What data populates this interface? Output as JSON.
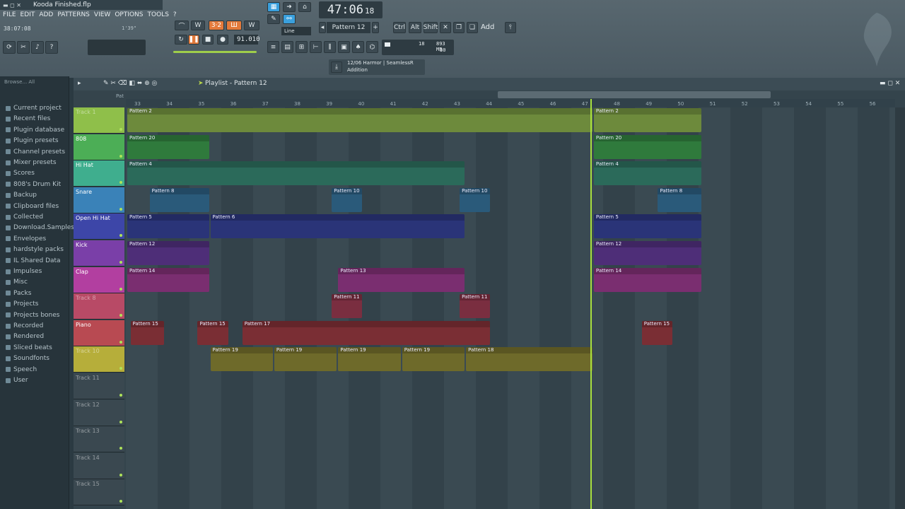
{
  "window": {
    "title": "Kooda Finished.flp"
  },
  "menu": [
    "FILE",
    "EDIT",
    "ADD",
    "PATTERNS",
    "VIEW",
    "OPTIONS",
    "TOOLS",
    "?"
  ],
  "hint": {
    "time": "38:07:08",
    "small": "1'39\""
  },
  "transport": {
    "time": "47:06",
    "time_sub": "18",
    "tempo": "91.010",
    "pattern": "Pattern 12",
    "snap": "Line",
    "pat_label": "Pat"
  },
  "shortcuts": [
    "Ctrl",
    "Alt",
    "Shift"
  ],
  "add_label": "Add",
  "cpu": {
    "value": "18",
    "mem": "893 MB",
    "poly": "30"
  },
  "hint_bar": {
    "line1": "12/06  Harmor | SeamlessR",
    "line2": "Addition"
  },
  "playlist": {
    "title": "Playlist - Pattern 12"
  },
  "browser": {
    "header": "Browse... All",
    "items": [
      "Current project",
      "Recent files",
      "Plugin database",
      "Plugin presets",
      "Channel presets",
      "Mixer presets",
      "Scores",
      "808's Drum Kit",
      "Backup",
      "Clipboard files",
      "Collected",
      "Download.Samples",
      "Envelopes",
      "hardstyle packs",
      "IL Shared Data",
      "Impulses",
      "Misc",
      "Packs",
      "Projects",
      "Projects bones",
      "Recorded",
      "Rendered",
      "Sliced beats",
      "Soundfonts",
      "Speech",
      "User"
    ]
  },
  "ruler": [
    "33",
    "34",
    "35",
    "36",
    "37",
    "38",
    "39",
    "40",
    "41",
    "42",
    "43",
    "44",
    "45",
    "46",
    "47",
    "48",
    "49",
    "50",
    "51",
    "52",
    "53",
    "54",
    "55",
    "56"
  ],
  "tracks": [
    {
      "name": "Track 1",
      "color": "#8fbf4a"
    },
    {
      "name": "808",
      "color": "#4cae56"
    },
    {
      "name": "Hi Hat",
      "color": "#3fae8e"
    },
    {
      "name": "Snare",
      "color": "#3a82b8"
    },
    {
      "name": "Open Hi Hat",
      "color": "#3d46a8"
    },
    {
      "name": "Kick",
      "color": "#7a3fa8"
    },
    {
      "name": "Clap",
      "color": "#b23fa0"
    },
    {
      "name": "Track 8",
      "color": "#b84a66"
    },
    {
      "name": "Piano",
      "color": "#b84a52"
    },
    {
      "name": "Track 10",
      "color": "#b6ae3a"
    },
    {
      "name": "Track 11",
      "color": "#3a4850"
    },
    {
      "name": "Track 12",
      "color": "#3a4850"
    },
    {
      "name": "Track 13",
      "color": "#3a4850"
    },
    {
      "name": "Track 14",
      "color": "#3a4850"
    },
    {
      "name": "Track 15",
      "color": "#3a4850"
    }
  ],
  "clips": [
    {
      "track": 0,
      "label": "Pattern 2",
      "start": 0,
      "end": 14.6,
      "color": "#6d8a3c"
    },
    {
      "track": 0,
      "label": "Pattern 2",
      "start": 14.6,
      "end": 18,
      "color": "#6d8a3c"
    },
    {
      "track": 1,
      "label": "Pattern 20",
      "start": 0,
      "end": 2.6,
      "color": "#2f7a3c"
    },
    {
      "track": 1,
      "label": "Pattern 20",
      "start": 14.6,
      "end": 18,
      "color": "#2f7a3c"
    },
    {
      "track": 2,
      "label": "Pattern 4",
      "start": 0,
      "end": 10.6,
      "color": "#2b6a5a"
    },
    {
      "track": 2,
      "label": "Pattern 4",
      "start": 14.6,
      "end": 18,
      "color": "#2b6a5a"
    },
    {
      "track": 3,
      "label": "Pattern 8",
      "start": 0.7,
      "end": 2.6,
      "color": "#2a5a7a"
    },
    {
      "track": 3,
      "label": "Pattern 10",
      "start": 6.4,
      "end": 7.4,
      "color": "#2a5a7a"
    },
    {
      "track": 3,
      "label": "Pattern 10",
      "start": 10.4,
      "end": 11.4,
      "color": "#2a5a7a"
    },
    {
      "track": 3,
      "label": "Pattern 8",
      "start": 16.6,
      "end": 18,
      "color": "#2a5a7a"
    },
    {
      "track": 4,
      "label": "Pattern 5",
      "start": 0,
      "end": 2.6,
      "color": "#2a3478"
    },
    {
      "track": 4,
      "label": "Pattern 6",
      "start": 2.6,
      "end": 10.6,
      "color": "#2a3478"
    },
    {
      "track": 4,
      "label": "Pattern 5",
      "start": 14.6,
      "end": 18,
      "color": "#2a3478"
    },
    {
      "track": 5,
      "label": "Pattern 12",
      "start": 0,
      "end": 2.6,
      "color": "#4e2e78"
    },
    {
      "track": 5,
      "label": "Pattern 12",
      "start": 14.6,
      "end": 18,
      "color": "#4e2e78"
    },
    {
      "track": 6,
      "label": "Pattern 14",
      "start": 0,
      "end": 2.6,
      "color": "#7a2e70"
    },
    {
      "track": 6,
      "label": "Pattern 13",
      "start": 6.6,
      "end": 10.6,
      "color": "#7a2e70"
    },
    {
      "track": 6,
      "label": "Pattern 14",
      "start": 14.6,
      "end": 18,
      "color": "#7a2e70"
    },
    {
      "track": 7,
      "label": "Pattern 11",
      "start": 6.4,
      "end": 7.4,
      "color": "#7a2e40"
    },
    {
      "track": 7,
      "label": "Pattern 11",
      "start": 10.4,
      "end": 11.4,
      "color": "#7a2e40"
    },
    {
      "track": 8,
      "label": "Pattern 15",
      "start": 0.1,
      "end": 1.2,
      "color": "#7a2e34"
    },
    {
      "track": 8,
      "label": "Pattern 15",
      "start": 2.2,
      "end": 3.2,
      "color": "#7a2e34"
    },
    {
      "track": 8,
      "label": "Pattern 17",
      "start": 3.6,
      "end": 11.4,
      "color": "#7a2e34"
    },
    {
      "track": 8,
      "label": "Pattern 15",
      "start": 16.1,
      "end": 17.1,
      "color": "#7a2e34"
    },
    {
      "track": 9,
      "label": "Pattern 19",
      "start": 2.6,
      "end": 4.6,
      "color": "#6e6a2a"
    },
    {
      "track": 9,
      "label": "Pattern 19",
      "start": 4.6,
      "end": 6.6,
      "color": "#6e6a2a"
    },
    {
      "track": 9,
      "label": "Pattern 19",
      "start": 6.6,
      "end": 8.6,
      "color": "#6e6a2a"
    },
    {
      "track": 9,
      "label": "Pattern 19",
      "start": 8.6,
      "end": 10.6,
      "color": "#6e6a2a"
    },
    {
      "track": 9,
      "label": "Pattern 18",
      "start": 10.6,
      "end": 14.6,
      "color": "#6e6a2a"
    }
  ]
}
